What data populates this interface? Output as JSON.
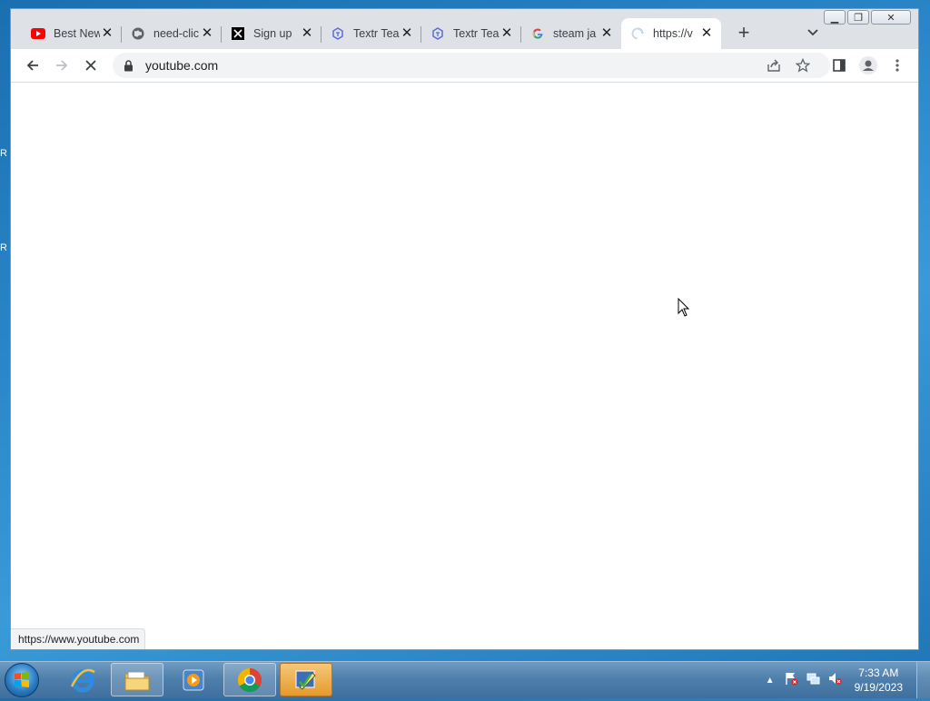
{
  "browser": {
    "tabs": [
      {
        "title": "Best New",
        "icon": "youtube-icon"
      },
      {
        "title": "need-clic",
        "icon": "globe-icon"
      },
      {
        "title": "Sign up",
        "icon": "x-logo-icon"
      },
      {
        "title": "Textr Tea",
        "icon": "textr-icon"
      },
      {
        "title": "Textr Tea",
        "icon": "textr-icon"
      },
      {
        "title": "steam ja",
        "icon": "google-icon"
      },
      {
        "title": "https://v",
        "icon": "loading-spinner-icon"
      }
    ],
    "address": {
      "url": "youtube.com"
    },
    "status_url": "https://www.youtube.com"
  },
  "taskbar": {
    "clock_time": "7:33 AM",
    "clock_date": "9/19/2023"
  },
  "desktop": {
    "letters": [
      "R",
      "R"
    ]
  },
  "colors": {
    "accent": "#1a73e8",
    "youtube_red": "#ff0000"
  }
}
